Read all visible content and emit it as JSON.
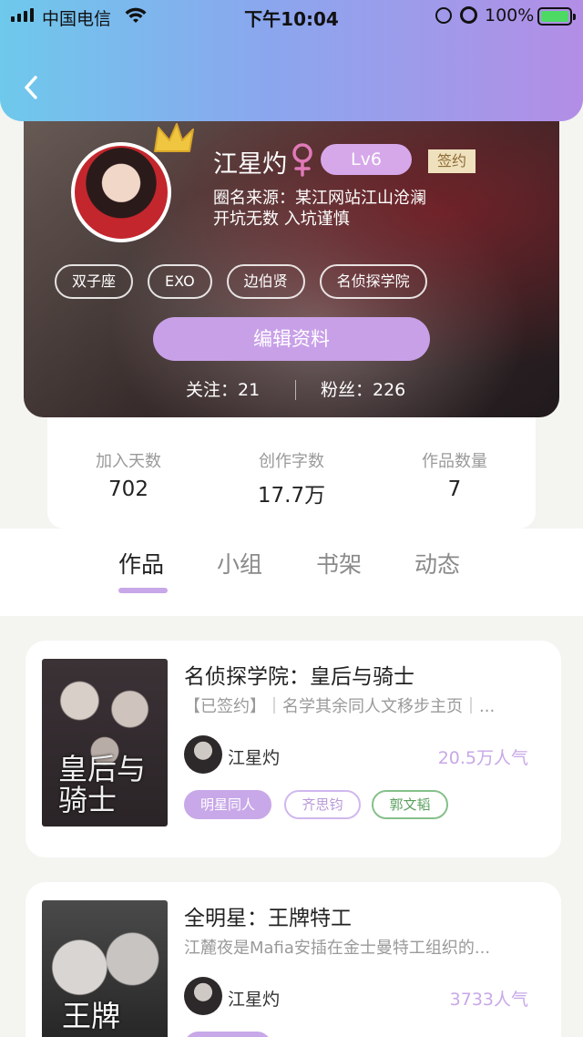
{
  "status_bar": {
    "carrier": "中国电信",
    "time": "下午10:04",
    "battery": "100%"
  },
  "profile": {
    "name": "江星灼",
    "level": "Lv6",
    "signed_badge": "签约",
    "bio_line1": "圈名来源：某江网站江山沧澜",
    "bio_line2": "开坑无数 入坑谨慎",
    "tags": [
      "双子座",
      "EXO",
      "边伯贤",
      "名侦探学院"
    ],
    "edit_button": "编辑资料",
    "follow_text": "关注：21",
    "fans_text": "粉丝：226"
  },
  "stats": [
    {
      "label": "加入天数",
      "value": "702"
    },
    {
      "label": "创作字数",
      "value": "17.7万"
    },
    {
      "label": "作品数量",
      "value": "7"
    }
  ],
  "tabs": [
    {
      "label": "作品"
    },
    {
      "label": "小组"
    },
    {
      "label": "书架"
    },
    {
      "label": "动态"
    }
  ],
  "works": [
    {
      "title": "名侦探学院：皇后与骑士",
      "desc": "【已签约】｜名学其余同人文移步主页｜...",
      "author": "江星灼",
      "popularity": "20.5万人气",
      "cover_text": "皇后与骑士",
      "chips": [
        {
          "label": "明星同人",
          "color": "#c8a8e8"
        },
        {
          "label": "齐思钧",
          "color": "#d0b8ee"
        },
        {
          "label": "郭文韬",
          "color": "#86c08a"
        }
      ]
    },
    {
      "title": "全明星：王牌特工",
      "desc": "江麓夜是Mafia安插在金士曼特工组织的...",
      "author": "江星灼",
      "popularity": "3733人气",
      "cover_text": "王牌"
    }
  ],
  "colors": {
    "accent": "#c8a8e8",
    "header_gradient_start": "#6ec9ec",
    "header_gradient_end": "#b38ee6"
  }
}
